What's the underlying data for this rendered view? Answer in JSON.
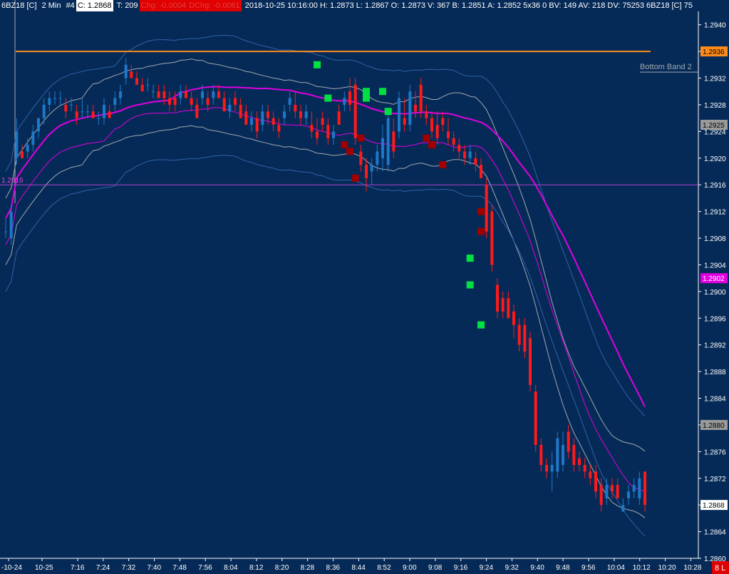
{
  "header": {
    "symbol": "6BZ18 [C]",
    "interval": "2 Min",
    "instance": "#4",
    "close": "C: 1.2868",
    "ticks": "T: 209",
    "chg": "Chg: -0.0004",
    "dchg": "DChg: -0.0061",
    "rest": "2018-10-25 10:16:00 H: 1.2873 L: 1.2867 O: 1.2873 V: 367 B: 1.2851 A: 1.2852 5x36 0 BV: 149 AV: 218 DV: 75253 6BZ18 [C] 75"
  },
  "colors": {
    "background": "#062a57",
    "up_candle": "#1e78c8",
    "down_candle": "#ff1a1a",
    "orange_line": "#ff8c1a",
    "magenta": "#e000e0",
    "band_line": "#a0a8b0",
    "green_marker": "#00e040",
    "darkred_marker": "#a00000"
  },
  "chart_data": {
    "type": "candlestick",
    "price_axis": {
      "min": 1.286,
      "max": 1.2942,
      "ticks": [
        "1.2940",
        "1.2936",
        "1.2932",
        "1.2928",
        "1.2925",
        "1.2924",
        "1.2920",
        "1.2916",
        "1.2912",
        "1.2908",
        "1.2904",
        "1.2902",
        "1.2900",
        "1.2896",
        "1.2892",
        "1.2888",
        "1.2884",
        "1.2880",
        "1.2876",
        "1.2872",
        "1.2868",
        "1.2864",
        "1.2860"
      ]
    },
    "tick_values": [
      1.294,
      1.2936,
      1.2932,
      1.2928,
      1.2924,
      1.292,
      1.2916,
      1.2912,
      1.2908,
      1.2904,
      1.29,
      1.2896,
      1.2892,
      1.2888,
      1.2884,
      1.288,
      1.2876,
      1.2872,
      1.2868,
      1.2864,
      1.286
    ],
    "time_axis": {
      "labels": [
        "-10-24",
        "10-25",
        "7:16",
        "7:24",
        "7:32",
        "7:40",
        "7:48",
        "7:56",
        "8:04",
        "8:12",
        "8:20",
        "8:28",
        "8:36",
        "8:44",
        "8:52",
        "9:00",
        "9:08",
        "9:16",
        "9:24",
        "9:32",
        "9:40",
        "9:48",
        "9:56",
        "10:04",
        "10:12",
        "10:20",
        "10:28"
      ]
    },
    "price_tags": [
      {
        "label": "1.2936",
        "value": 1.2936,
        "bg": "#ff8c1a",
        "fg": "#000000"
      },
      {
        "label": "1.2925",
        "value": 1.2925,
        "bg": "#9a9a9a",
        "fg": "#000000"
      },
      {
        "label": "1.2902",
        "value": 1.2902,
        "bg": "#e000e0",
        "fg": "#ffffff"
      },
      {
        "label": "1.2880",
        "value": 1.288,
        "bg": "#9a9a9a",
        "fg": "#000000"
      },
      {
        "label": "1.2868",
        "value": 1.2868,
        "bg": "#ffffff",
        "fg": "#000000"
      }
    ],
    "horizontal_lines": [
      {
        "value": 1.2936,
        "color": "#ff8c1a"
      },
      {
        "value": 1.2916,
        "color": "#b040d0",
        "label": "1.2916"
      }
    ],
    "annotations": [
      {
        "text": "Bottom Band 2",
        "value": 1.2933
      }
    ],
    "corner_badge": "8 L",
    "candles": [
      {
        "o": 1.2909,
        "h": 1.2911,
        "l": 1.2908,
        "c": 1.2909
      },
      {
        "o": 1.2908,
        "h": 1.2913,
        "l": 1.2907,
        "c": 1.2912
      },
      {
        "o": 1.292,
        "h": 1.2926,
        "l": 1.2919,
        "c": 1.2924
      },
      {
        "o": 1.2921,
        "h": 1.2922,
        "l": 1.292,
        "c": 1.292
      },
      {
        "o": 1.2921,
        "h": 1.2923,
        "l": 1.292,
        "c": 1.2922
      },
      {
        "o": 1.2922,
        "h": 1.2925,
        "l": 1.2921,
        "c": 1.2924
      },
      {
        "o": 1.2924,
        "h": 1.2926,
        "l": 1.2923,
        "c": 1.2926
      },
      {
        "o": 1.2926,
        "h": 1.2929,
        "l": 1.2925,
        "c": 1.2928
      },
      {
        "o": 1.2928,
        "h": 1.293,
        "l": 1.2927,
        "c": 1.2929
      },
      {
        "o": 1.2929,
        "h": 1.293,
        "l": 1.2928,
        "c": 1.2929
      },
      {
        "o": 1.2929,
        "h": 1.293,
        "l": 1.2928,
        "c": 1.2929
      },
      {
        "o": 1.2928,
        "h": 1.2929,
        "l": 1.2926,
        "c": 1.2927
      },
      {
        "o": 1.2928,
        "h": 1.2929,
        "l": 1.2927,
        "c": 1.2928
      },
      {
        "o": 1.2927,
        "h": 1.2928,
        "l": 1.2925,
        "c": 1.2926
      },
      {
        "o": 1.2927,
        "h": 1.2929,
        "l": 1.2926,
        "c": 1.2927
      },
      {
        "o": 1.2927,
        "h": 1.2928,
        "l": 1.2926,
        "c": 1.2927
      },
      {
        "o": 1.2927,
        "h": 1.2928,
        "l": 1.2926,
        "c": 1.2926
      },
      {
        "o": 1.2926,
        "h": 1.2927,
        "l": 1.2925,
        "c": 1.2926
      },
      {
        "o": 1.2926,
        "h": 1.2929,
        "l": 1.2925,
        "c": 1.2928
      },
      {
        "o": 1.2927,
        "h": 1.2928,
        "l": 1.2926,
        "c": 1.2926
      },
      {
        "o": 1.2928,
        "h": 1.293,
        "l": 1.2927,
        "c": 1.2929
      },
      {
        "o": 1.2929,
        "h": 1.2931,
        "l": 1.2928,
        "c": 1.293
      },
      {
        "o": 1.2932,
        "h": 1.2935,
        "l": 1.2931,
        "c": 1.2934
      },
      {
        "o": 1.2933,
        "h": 1.2934,
        "l": 1.2932,
        "c": 1.2932
      },
      {
        "o": 1.2932,
        "h": 1.2933,
        "l": 1.2931,
        "c": 1.2931
      },
      {
        "o": 1.2931,
        "h": 1.2932,
        "l": 1.293,
        "c": 1.293
      },
      {
        "o": 1.2931,
        "h": 1.2932,
        "l": 1.293,
        "c": 1.2931
      },
      {
        "o": 1.293,
        "h": 1.2931,
        "l": 1.2929,
        "c": 1.293
      },
      {
        "o": 1.293,
        "h": 1.2931,
        "l": 1.2929,
        "c": 1.2929
      },
      {
        "o": 1.293,
        "h": 1.2931,
        "l": 1.2928,
        "c": 1.2929
      },
      {
        "o": 1.2929,
        "h": 1.293,
        "l": 1.2927,
        "c": 1.2928
      },
      {
        "o": 1.2929,
        "h": 1.293,
        "l": 1.2927,
        "c": 1.2928
      },
      {
        "o": 1.2929,
        "h": 1.2931,
        "l": 1.2928,
        "c": 1.293
      },
      {
        "o": 1.293,
        "h": 1.2931,
        "l": 1.2929,
        "c": 1.2929
      },
      {
        "o": 1.2929,
        "h": 1.293,
        "l": 1.2927,
        "c": 1.2928
      },
      {
        "o": 1.2928,
        "h": 1.2929,
        "l": 1.2926,
        "c": 1.2926
      },
      {
        "o": 1.2929,
        "h": 1.2931,
        "l": 1.2928,
        "c": 1.293
      },
      {
        "o": 1.2929,
        "h": 1.293,
        "l": 1.2927,
        "c": 1.2928
      },
      {
        "o": 1.2929,
        "h": 1.2931,
        "l": 1.2928,
        "c": 1.293
      },
      {
        "o": 1.293,
        "h": 1.2931,
        "l": 1.2929,
        "c": 1.2929
      },
      {
        "o": 1.2929,
        "h": 1.293,
        "l": 1.2927,
        "c": 1.2927
      },
      {
        "o": 1.2927,
        "h": 1.2929,
        "l": 1.2926,
        "c": 1.2928
      },
      {
        "o": 1.2929,
        "h": 1.293,
        "l": 1.2927,
        "c": 1.2928
      },
      {
        "o": 1.2928,
        "h": 1.2929,
        "l": 1.2926,
        "c": 1.2926
      },
      {
        "o": 1.2927,
        "h": 1.2928,
        "l": 1.2925,
        "c": 1.2925
      },
      {
        "o": 1.2925,
        "h": 1.2927,
        "l": 1.2924,
        "c": 1.2926
      },
      {
        "o": 1.2926,
        "h": 1.2927,
        "l": 1.2923,
        "c": 1.2924
      },
      {
        "o": 1.2925,
        "h": 1.2928,
        "l": 1.2924,
        "c": 1.2927
      },
      {
        "o": 1.2927,
        "h": 1.2928,
        "l": 1.2925,
        "c": 1.2926
      },
      {
        "o": 1.2926,
        "h": 1.2927,
        "l": 1.2924,
        "c": 1.2925
      },
      {
        "o": 1.2925,
        "h": 1.2926,
        "l": 1.2923,
        "c": 1.2924
      },
      {
        "o": 1.2926,
        "h": 1.2928,
        "l": 1.2925,
        "c": 1.2927
      },
      {
        "o": 1.2928,
        "h": 1.293,
        "l": 1.2927,
        "c": 1.2929
      },
      {
        "o": 1.2928,
        "h": 1.293,
        "l": 1.2926,
        "c": 1.2927
      },
      {
        "o": 1.2927,
        "h": 1.2928,
        "l": 1.2925,
        "c": 1.2926
      },
      {
        "o": 1.2926,
        "h": 1.2928,
        "l": 1.2925,
        "c": 1.2927
      },
      {
        "o": 1.2925,
        "h": 1.2927,
        "l": 1.2923,
        "c": 1.2924
      },
      {
        "o": 1.2924,
        "h": 1.2926,
        "l": 1.2922,
        "c": 1.2923
      },
      {
        "o": 1.2926,
        "h": 1.2927,
        "l": 1.2924,
        "c": 1.2925
      },
      {
        "o": 1.2925,
        "h": 1.2926,
        "l": 1.2922,
        "c": 1.2923
      },
      {
        "o": 1.2923,
        "h": 1.2925,
        "l": 1.2922,
        "c": 1.2924
      },
      {
        "o": 1.2927,
        "h": 1.2928,
        "l": 1.2925,
        "c": 1.2925
      },
      {
        "o": 1.2928,
        "h": 1.293,
        "l": 1.2927,
        "c": 1.2929
      },
      {
        "o": 1.293,
        "h": 1.2932,
        "l": 1.2927,
        "c": 1.2928
      },
      {
        "o": 1.2931,
        "h": 1.2932,
        "l": 1.2922,
        "c": 1.2923
      },
      {
        "o": 1.2921,
        "h": 1.2922,
        "l": 1.2918,
        "c": 1.2919
      },
      {
        "o": 1.2919,
        "h": 1.292,
        "l": 1.2915,
        "c": 1.2917
      },
      {
        "o": 1.2918,
        "h": 1.292,
        "l": 1.2916,
        "c": 1.2919
      },
      {
        "o": 1.2919,
        "h": 1.2922,
        "l": 1.2918,
        "c": 1.2921
      },
      {
        "o": 1.292,
        "h": 1.2925,
        "l": 1.2918,
        "c": 1.2923
      },
      {
        "o": 1.2919,
        "h": 1.2927,
        "l": 1.2918,
        "c": 1.2926
      },
      {
        "o": 1.2924,
        "h": 1.2926,
        "l": 1.292,
        "c": 1.2921
      },
      {
        "o": 1.2924,
        "h": 1.293,
        "l": 1.2923,
        "c": 1.2929
      },
      {
        "o": 1.2926,
        "h": 1.2929,
        "l": 1.2924,
        "c": 1.2925
      },
      {
        "o": 1.2925,
        "h": 1.2931,
        "l": 1.2924,
        "c": 1.293
      },
      {
        "o": 1.2928,
        "h": 1.293,
        "l": 1.2926,
        "c": 1.2927
      },
      {
        "o": 1.2931,
        "h": 1.2932,
        "l": 1.2926,
        "c": 1.2927
      },
      {
        "o": 1.2927,
        "h": 1.2928,
        "l": 1.2925,
        "c": 1.2926
      },
      {
        "o": 1.2926,
        "h": 1.2927,
        "l": 1.2923,
        "c": 1.2924
      },
      {
        "o": 1.2925,
        "h": 1.2927,
        "l": 1.2922,
        "c": 1.2923
      },
      {
        "o": 1.2926,
        "h": 1.2927,
        "l": 1.2924,
        "c": 1.2925
      },
      {
        "o": 1.2924,
        "h": 1.2926,
        "l": 1.2922,
        "c": 1.2923
      },
      {
        "o": 1.2923,
        "h": 1.2924,
        "l": 1.2921,
        "c": 1.2922
      },
      {
        "o": 1.2922,
        "h": 1.2923,
        "l": 1.292,
        "c": 1.2921
      },
      {
        "o": 1.2921,
        "h": 1.2922,
        "l": 1.2919,
        "c": 1.292
      },
      {
        "o": 1.292,
        "h": 1.2922,
        "l": 1.2919,
        "c": 1.2921
      },
      {
        "o": 1.292,
        "h": 1.2921,
        "l": 1.2918,
        "c": 1.2919
      },
      {
        "o": 1.2919,
        "h": 1.292,
        "l": 1.2917,
        "c": 1.2917
      },
      {
        "o": 1.2916,
        "h": 1.2917,
        "l": 1.2908,
        "c": 1.2909
      },
      {
        "o": 1.2912,
        "h": 1.2913,
        "l": 1.2903,
        "c": 1.2904
      },
      {
        "o": 1.2901,
        "h": 1.2902,
        "l": 1.2896,
        "c": 1.2897
      },
      {
        "o": 1.2899,
        "h": 1.29,
        "l": 1.2896,
        "c": 1.2897
      },
      {
        "o": 1.2899,
        "h": 1.29,
        "l": 1.2896,
        "c": 1.2896
      },
      {
        "o": 1.2897,
        "h": 1.2898,
        "l": 1.2893,
        "c": 1.2895
      },
      {
        "o": 1.2895,
        "h": 1.2896,
        "l": 1.2891,
        "c": 1.2892
      },
      {
        "o": 1.2895,
        "h": 1.2896,
        "l": 1.289,
        "c": 1.2891
      },
      {
        "o": 1.2893,
        "h": 1.2894,
        "l": 1.2885,
        "c": 1.2886
      },
      {
        "o": 1.2885,
        "h": 1.2886,
        "l": 1.2876,
        "c": 1.2877
      },
      {
        "o": 1.2877,
        "h": 1.2878,
        "l": 1.2873,
        "c": 1.2874
      },
      {
        "o": 1.2874,
        "h": 1.2875,
        "l": 1.2872,
        "c": 1.2873
      },
      {
        "o": 1.2873,
        "h": 1.2876,
        "l": 1.287,
        "c": 1.2874
      },
      {
        "o": 1.2873,
        "h": 1.2879,
        "l": 1.2872,
        "c": 1.2878
      },
      {
        "o": 1.2874,
        "h": 1.2879,
        "l": 1.2873,
        "c": 1.2877
      },
      {
        "o": 1.2879,
        "h": 1.288,
        "l": 1.2875,
        "c": 1.2876
      },
      {
        "o": 1.2877,
        "h": 1.2878,
        "l": 1.2873,
        "c": 1.2874
      },
      {
        "o": 1.2875,
        "h": 1.2876,
        "l": 1.2873,
        "c": 1.2874
      },
      {
        "o": 1.2874,
        "h": 1.2875,
        "l": 1.2872,
        "c": 1.2873
      },
      {
        "o": 1.2873,
        "h": 1.2874,
        "l": 1.2871,
        "c": 1.2872
      },
      {
        "o": 1.2873,
        "h": 1.2874,
        "l": 1.2869,
        "c": 1.287
      },
      {
        "o": 1.2871,
        "h": 1.2872,
        "l": 1.2867,
        "c": 1.2868
      },
      {
        "o": 1.2869,
        "h": 1.2872,
        "l": 1.2868,
        "c": 1.2871
      },
      {
        "o": 1.2871,
        "h": 1.2872,
        "l": 1.2869,
        "c": 1.287
      },
      {
        "o": 1.2871,
        "h": 1.2872,
        "l": 1.2869,
        "c": 1.2869
      },
      {
        "o": 1.2867,
        "h": 1.2869,
        "l": 1.2867,
        "c": 1.2868
      },
      {
        "o": 1.2869,
        "h": 1.2871,
        "l": 1.2868,
        "c": 1.287
      },
      {
        "o": 1.287,
        "h": 1.2872,
        "l": 1.2869,
        "c": 1.2871
      },
      {
        "o": 1.2869,
        "h": 1.2873,
        "l": 1.2868,
        "c": 1.2872
      },
      {
        "o": 1.2873,
        "h": 1.2873,
        "l": 1.2867,
        "c": 1.2868
      }
    ],
    "green_markers": [
      1.2934,
      1.2929,
      1.293,
      1.2929,
      1.293,
      1.2927,
      1.2905,
      1.2901,
      1.2895
    ],
    "darkred_markers": [
      1.2922,
      1.2921,
      1.2923,
      1.2917,
      1.2923,
      1.2922,
      1.2919,
      1.2912,
      1.2909
    ]
  }
}
